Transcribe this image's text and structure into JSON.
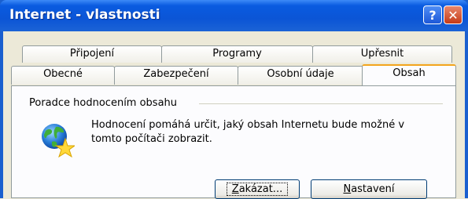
{
  "window": {
    "title": "Internet - vlastnosti",
    "help_label": "?",
    "close_label": "✕"
  },
  "tabs": {
    "row_back": [
      {
        "label": "Připojení"
      },
      {
        "label": "Programy"
      },
      {
        "label": "Upřesnit"
      }
    ],
    "row_front": [
      {
        "label": "Obecné"
      },
      {
        "label": "Zabezpečení"
      },
      {
        "label": "Osobní údaje"
      },
      {
        "label": "Obsah",
        "active": true
      }
    ]
  },
  "content_advisor": {
    "group_title": "Poradce hodnocením obsahu",
    "description": "Hodnocení pomáhá určit, jaký obsah Internetu bude možné v tomto počítači zobrazit.",
    "icon": "globe-star-icon",
    "disable_button": {
      "mnemonic": "Z",
      "rest": "akázat..."
    },
    "settings_button": {
      "mnemonic": "N",
      "rest": "astavení"
    }
  },
  "colors": {
    "titlebar": "#0b55d6",
    "active_tab_accent": "#f3a41c",
    "close_button": "#c53a17",
    "dialog_bg": "#ece9d8"
  }
}
